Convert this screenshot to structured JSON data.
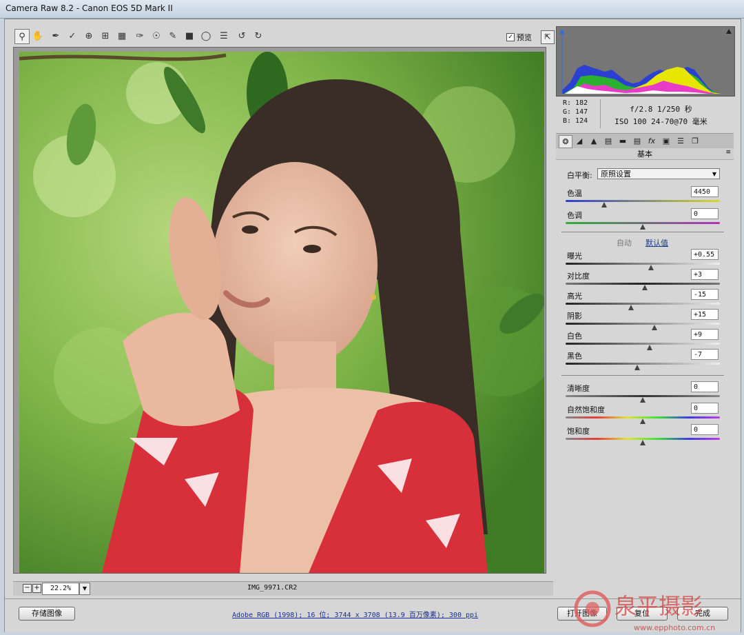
{
  "window": {
    "title": "Camera Raw 8.2 -  Canon EOS 5D Mark II"
  },
  "toolbar": {
    "icons": [
      "zoom-icon",
      "hand-icon",
      "white-balance-icon",
      "color-sampler-icon",
      "targeted-adjustment-icon",
      "crop-icon",
      "straighten-icon",
      "spot-removal-icon",
      "red-eye-icon",
      "adjustment-brush-icon",
      "graduated-filter-icon",
      "radial-filter-icon",
      "preferences-icon",
      "rotate-left-icon",
      "rotate-right-icon"
    ],
    "preview_label": "预览",
    "preview_checked": true
  },
  "status": {
    "zoom": "22.2%",
    "filename": "IMG_9971.CR2"
  },
  "readout": {
    "r": "R:  182",
    "g": "G:  147",
    "b": "B:  124",
    "exposure_line": "f/2.8   1/250 秒",
    "iso_line": "ISO 100   24-70@70 毫米"
  },
  "panel": {
    "section_title": "基本",
    "white_balance_label": "白平衡:",
    "white_balance_value": "原照设置",
    "auto_label": "自动",
    "default_label": "默认值",
    "sliders": [
      {
        "label": "色温",
        "value": "4450",
        "pos": 0.25
      },
      {
        "label": "色调",
        "value": "0",
        "pos": 0.5
      },
      {
        "label": "曝光",
        "value": "+0.55",
        "pos": 0.555
      },
      {
        "label": "对比度",
        "value": "+3",
        "pos": 0.515
      },
      {
        "label": "高光",
        "value": "-15",
        "pos": 0.425
      },
      {
        "label": "阴影",
        "value": "+15",
        "pos": 0.575
      },
      {
        "label": "白色",
        "value": "+9",
        "pos": 0.545
      },
      {
        "label": "黑色",
        "value": "-7",
        "pos": 0.465
      },
      {
        "label": "清晰度",
        "value": "0",
        "pos": 0.5
      },
      {
        "label": "自然饱和度",
        "value": "0",
        "pos": 0.5
      },
      {
        "label": "饱和度",
        "value": "0",
        "pos": 0.5
      }
    ]
  },
  "bottom": {
    "save_label": "存储图像",
    "workflow_info": "Adobe RGB (1998); 16 位; 3744 x 3708 (13.9 百万像素); 300 ppi",
    "open_label": "打开图像",
    "reset_label": "复位",
    "done_label": "完成"
  },
  "watermark": {
    "brand": "泉平摄影",
    "url": "www.epphoto.com.cn"
  },
  "colors": {
    "window_bg": "#d6d6d6",
    "link_blue": "#1a2f8f",
    "temp_start": "#2b3fd0",
    "temp_end": "#d8d82a",
    "tint_start": "#2fae3a",
    "tint_end": "#b132b8"
  }
}
